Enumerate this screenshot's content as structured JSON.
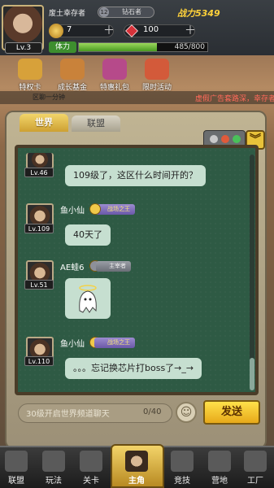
{
  "player": {
    "name": "废土幸存者",
    "level": "Lv.3",
    "rank_badge": "12",
    "rank_value": "钻石者",
    "power": "战力5349"
  },
  "resources": {
    "gold": "7",
    "gems": "100",
    "stamina_label": "体力",
    "stamina_text": "485/800",
    "stamina_fraction": 0.606
  },
  "menu": [
    {
      "label": "特权卡",
      "icon": "privilege-card-icon",
      "color": "#d7a13a"
    },
    {
      "label": "成长基金",
      "icon": "growth-fund-icon",
      "color": "#c9823a"
    },
    {
      "label": "特惠礼包",
      "icon": "gift-pack-icon",
      "color": "#b64a8a"
    },
    {
      "label": "限时活动",
      "icon": "timed-event-icon",
      "color": "#d35a3a"
    }
  ],
  "ticker": {
    "text": "虚假广告套路深，幸存者",
    "left_text": "区聊一分钟"
  },
  "tabs": {
    "world": "世界",
    "alliance": "联盟"
  },
  "messages": [
    {
      "name": "",
      "level": "Lv.46",
      "text": "109级了，这区什么时间开的？",
      "tag": ""
    },
    {
      "name": "鱼小仙",
      "level": "Lv.109",
      "text": "40天了",
      "tag": "战场之王"
    },
    {
      "name": "AE蛙6",
      "level": "Lv.51",
      "text": "",
      "tag": "主宰者"
    },
    {
      "name": "鱼小仙",
      "level": "Lv.110",
      "text": "。。。忘记换芯片打boss了→_→",
      "tag": "战场之王"
    }
  ],
  "input": {
    "placeholder": "30级开启世界频道聊天",
    "count": "0/40",
    "send": "发送"
  },
  "nav": [
    {
      "label": "联盟",
      "icon": "alliance-icon"
    },
    {
      "label": "玩法",
      "icon": "gameplay-icon"
    },
    {
      "label": "关卡",
      "icon": "stage-icon"
    },
    {
      "label": "主角",
      "icon": "hero-icon"
    },
    {
      "label": "竞技",
      "icon": "arena-icon"
    },
    {
      "label": "营地",
      "icon": "camp-icon"
    },
    {
      "label": "工厂",
      "icon": "factory-icon"
    }
  ]
}
